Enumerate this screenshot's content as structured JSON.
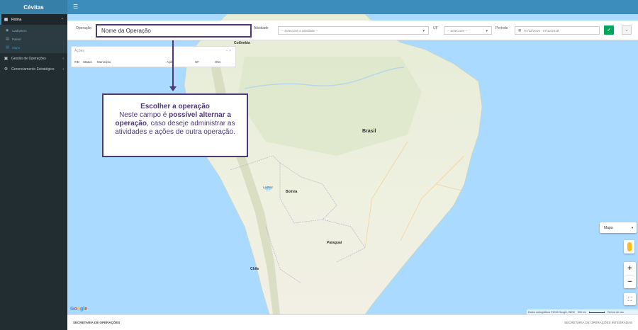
{
  "app": {
    "brand": "Cévitas"
  },
  "sidebar": {
    "items": [
      {
        "label": "Rotina",
        "icon": "dashboard-icon",
        "open": true,
        "children": [
          {
            "label": "Cadastros",
            "icon": "circle-icon"
          },
          {
            "label": "Painel",
            "icon": "table-icon"
          },
          {
            "label": "Mapa",
            "icon": "map-icon",
            "active": true
          }
        ]
      },
      {
        "label": "Gestão de Operações",
        "icon": "briefcase-icon"
      },
      {
        "label": "Gerenciamento Estratégico",
        "icon": "cog-icon"
      }
    ]
  },
  "filters": {
    "operacao_label": "Operação",
    "operacao_value": "Nome da Operação",
    "atividade_label": "Atividade",
    "atividade_placeholder": "-- Selecione a atividade --",
    "uf_label": "UF",
    "uf_placeholder": "-- Selecione --",
    "periodo_label": "Período",
    "periodo_value": "07/12/2019 - 07/12/2019"
  },
  "acoes": {
    "title": "Ações",
    "columns": [
      "Status",
      "Município",
      "Ação",
      "UF",
      "Obs"
    ]
  },
  "callout": {
    "title": "Escolher a operação",
    "pre": "Neste campo é ",
    "bold1": "possível alternar a operação",
    "post": ", caso deseje administrar as atividades e ações de outra operação."
  },
  "map": {
    "labels": {
      "colombia": "Colômbia",
      "brasil": "Brasil",
      "bolivia": "Bolívia",
      "paraguai": "Paraguai",
      "chile": "Chile",
      "la_paz": "La Paz"
    },
    "type_selector": "Mapa",
    "google": "Google",
    "attribution": "Dados cartográficos ©2019 Google, INEGI",
    "scale": "500 km",
    "terms": "Termos de uso"
  },
  "footer": {
    "left": "SECRETARIA DE OPERAÇÕES",
    "right": "SECRETARIA DE OPERAÇÕES INTEGRADAS"
  },
  "colors": {
    "header": "#3c8dbc",
    "sidebar": "#222d32",
    "callout_border": "#4d3a75",
    "ocean": "#aadaff",
    "land": "#e9eedb",
    "go_button": "#00a65a"
  }
}
